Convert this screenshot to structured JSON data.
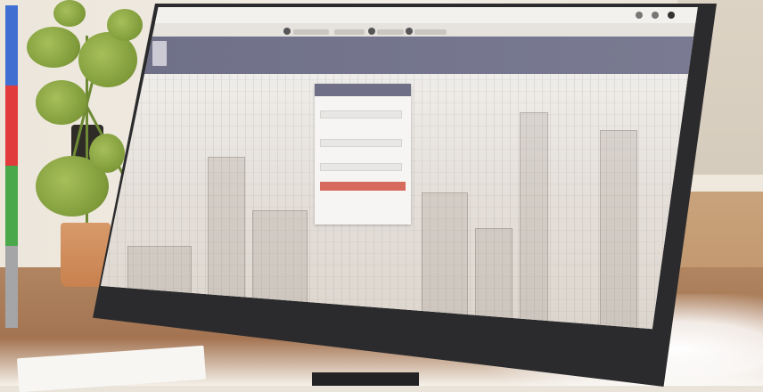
{
  "browser": {
    "bookmarks": [
      "",
      "",
      "",
      "",
      ""
    ],
    "window_controls": [
      "",
      "",
      ""
    ]
  },
  "app": {
    "title": "",
    "logo_icon": "app-logo-icon"
  },
  "login": {
    "header": "",
    "username_label": "",
    "username_placeholder": "",
    "email_label": "",
    "email_placeholder": "",
    "password_label": "",
    "password_placeholder": "",
    "submit_label": "",
    "footer_text": ""
  },
  "taskbar": {
    "search_placeholder": ""
  },
  "colors": {
    "header": "#6f7088",
    "button": "#d56a5d",
    "strip": [
      "#3f6fd0",
      "#e23b3b",
      "#4aa84a",
      "#a5a5a8"
    ]
  }
}
